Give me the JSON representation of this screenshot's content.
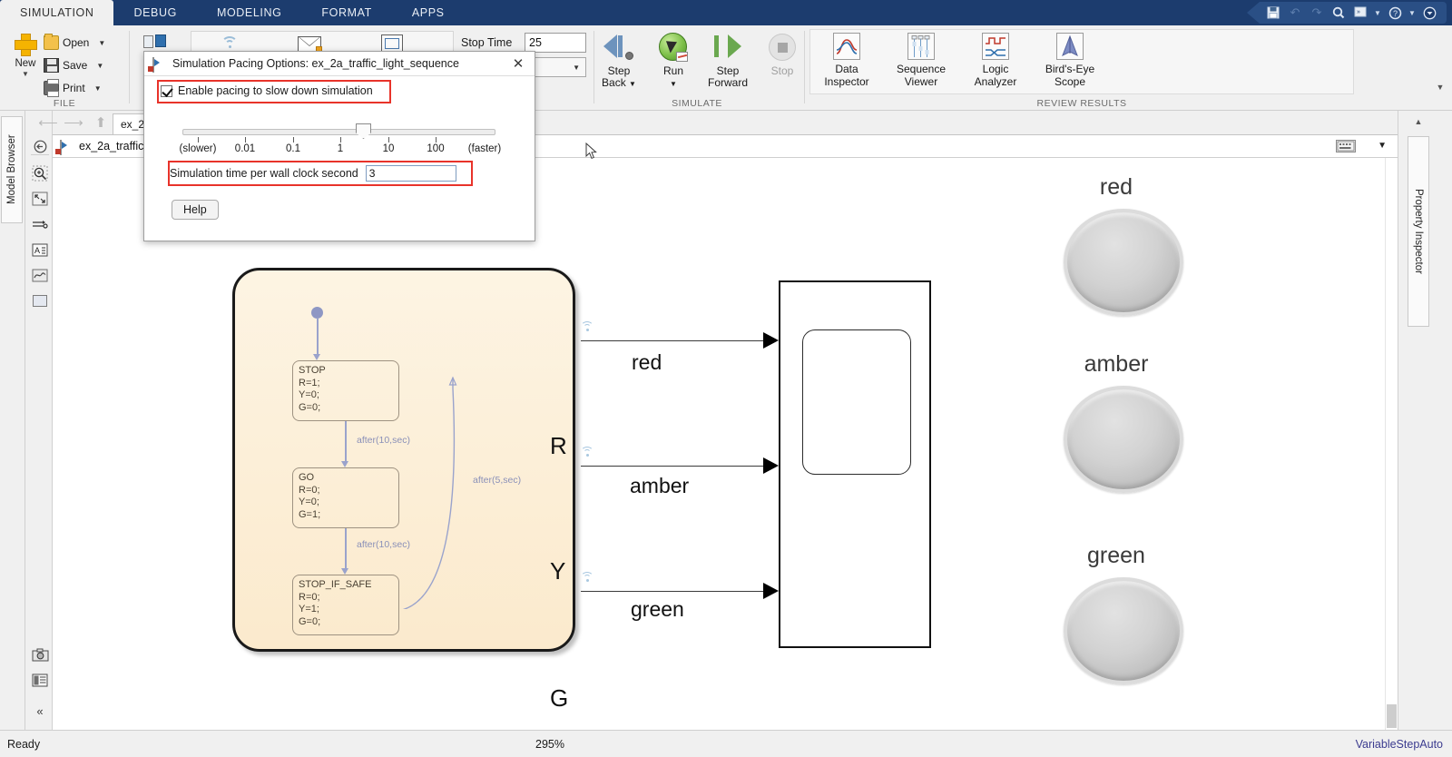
{
  "window": {
    "ribbon_tabs": [
      {
        "label": "SIMULATION",
        "active": true
      },
      {
        "label": "DEBUG",
        "active": false
      },
      {
        "label": "MODELING",
        "active": false
      },
      {
        "label": "FORMAT",
        "active": false
      },
      {
        "label": "APPS",
        "active": false
      }
    ],
    "quick_access": [
      {
        "name": "save-icon",
        "glyph": "ὋE"
      },
      {
        "name": "undo-icon",
        "glyph": "↶"
      },
      {
        "name": "redo-icon",
        "glyph": "↷"
      },
      {
        "name": "search-icon",
        "glyph": "ὐD"
      },
      {
        "name": "shortcuts-icon",
        "glyph": "»"
      },
      {
        "name": "help-icon",
        "glyph": "?"
      },
      {
        "name": "more-icon",
        "glyph": "▼"
      }
    ]
  },
  "ribbon": {
    "file_group": {
      "label": "FILE",
      "new_label": "New",
      "items": [
        {
          "label": "Open",
          "icon": "folder-icon"
        },
        {
          "label": "Save",
          "icon": "floppy-icon"
        },
        {
          "label": "Print",
          "icon": "printer-icon"
        }
      ]
    },
    "prepare_group": {
      "label": "",
      "stop_time_label": "Stop Time",
      "stop_time_value": "25"
    },
    "simulate_group": {
      "label": "SIMULATE",
      "buttons": [
        {
          "label_line1": "Step",
          "label_line2": "Back",
          "name": "step-back-button",
          "disabled": false,
          "has_caret": true
        },
        {
          "label_line1": "Run",
          "label_line2": "",
          "name": "run-button",
          "disabled": false,
          "has_caret": true
        },
        {
          "label_line1": "Step",
          "label_line2": "Forward",
          "name": "step-forward-button",
          "disabled": false,
          "has_caret": false
        },
        {
          "label_line1": "Stop",
          "label_line2": "",
          "name": "stop-button",
          "disabled": true,
          "has_caret": false
        }
      ]
    },
    "review_group": {
      "label": "REVIEW RESULTS",
      "buttons": [
        {
          "label_line1": "Data",
          "label_line2": "Inspector",
          "name": "data-inspector-button"
        },
        {
          "label_line1": "Sequence",
          "label_line2": "Viewer",
          "name": "sequence-viewer-button"
        },
        {
          "label_line1": "Logic",
          "label_line2": "Analyzer",
          "name": "logic-analyzer-button"
        },
        {
          "label_line1": "Bird's-Eye",
          "label_line2": "Scope",
          "name": "birds-eye-scope-button"
        }
      ]
    }
  },
  "left_rail": {
    "model_browser_label": "Model Browser",
    "tools": [
      {
        "name": "navigate-up-icon",
        "glyph": "⊕"
      },
      {
        "name": "zoom-region-icon",
        "glyph": "⌕"
      },
      {
        "name": "fit-to-view-icon",
        "glyph": "⛶"
      },
      {
        "name": "signal-routing-icon",
        "glyph": "⇥"
      },
      {
        "name": "annotation-icon",
        "glyph": "A"
      },
      {
        "name": "scope-viewer-icon",
        "glyph": "∿"
      },
      {
        "name": "subsystem-icon",
        "glyph": "▢"
      },
      {
        "name": "snapshot-icon",
        "glyph": "὏7"
      },
      {
        "name": "report-icon",
        "glyph": "▤"
      },
      {
        "name": "collapse-rail-icon",
        "glyph": "«"
      }
    ]
  },
  "breadcrumb": {
    "model_tab_label": "ex_2a",
    "path_label": "ex_2a_traffic_l",
    "keyboard_icon": "keyboard-icon",
    "caret": "▼"
  },
  "right_panel": {
    "property_inspector_label": "Property Inspector",
    "collapse_glyph": "▲"
  },
  "status_bar": {
    "ready": "Ready",
    "zoom": "295%",
    "solver": "VariableStepAuto"
  },
  "canvas": {
    "chart": {
      "states": [
        {
          "name": "STOP",
          "body": "R=1;\nY=0;\nG=0;"
        },
        {
          "name": "GO",
          "body": "R=0;\nY=0;\nG=1;"
        },
        {
          "name": "STOP_IF_SAFE",
          "body": "R=0;\nY=1;\nG=0;"
        }
      ],
      "transitions": [
        {
          "label": "after(10,sec)",
          "from": "STOP",
          "to": "GO"
        },
        {
          "label": "after(10,sec)",
          "from": "GO",
          "to": "STOP_IF_SAFE"
        },
        {
          "label": "after(5,sec)",
          "from": "STOP_IF_SAFE",
          "to": "STOP"
        }
      ],
      "output_ports": [
        "R",
        "Y",
        "G"
      ]
    },
    "signals": [
      {
        "label": "red"
      },
      {
        "label": "amber"
      },
      {
        "label": "green"
      }
    ],
    "lamps": [
      {
        "label": "red",
        "state": "off",
        "color": "#c9c9c9"
      },
      {
        "label": "amber",
        "state": "off",
        "color": "#c9c9c9"
      },
      {
        "label": "green",
        "state": "off",
        "color": "#c9c9c9"
      }
    ]
  },
  "dialog": {
    "title": "Simulation Pacing Options: ex_2a_traffic_light_sequence",
    "close_glyph": "✕",
    "checkbox_label": "Enable pacing to slow down simulation",
    "checkbox_checked": true,
    "slider": {
      "tick_labels": [
        "(slower)",
        "0.01",
        "0.1",
        "1",
        "10",
        "100",
        "(faster)"
      ],
      "thumb_position_value": "3"
    },
    "wall_clock_label": "Simulation time per wall clock second",
    "wall_clock_value": "3",
    "help_label": "Help",
    "highlight_color": "#e8332a"
  }
}
